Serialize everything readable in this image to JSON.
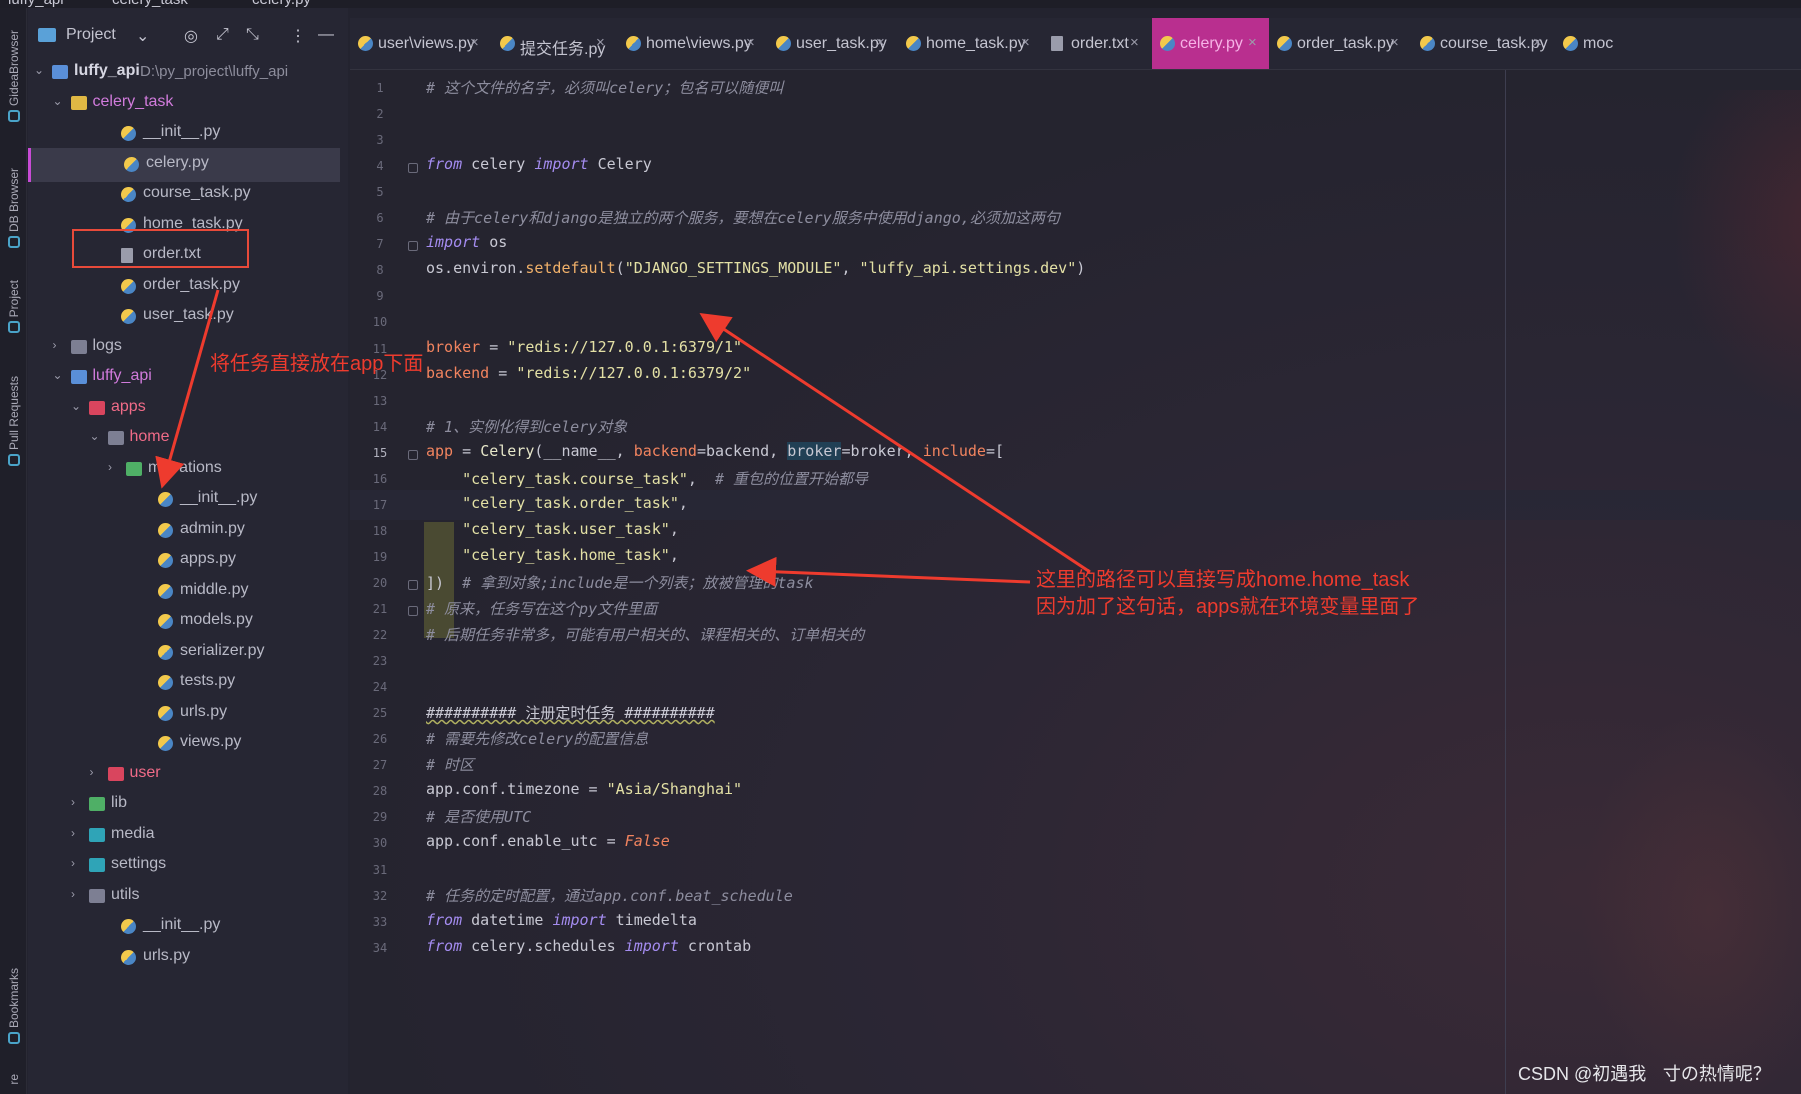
{
  "breadcrumb": {
    "project": "luffy_api",
    "folder": "celery_task",
    "file": "celery.py"
  },
  "left_strip": [
    {
      "label": "GideaBrowser",
      "icon": "gidea-icon"
    },
    {
      "label": "DB Browser",
      "icon": "database-icon"
    },
    {
      "label": "Project",
      "icon": "project-icon"
    },
    {
      "label": "Pull Requests",
      "icon": "github-icon"
    },
    {
      "label": "Bookmarks",
      "icon": "bookmark-icon"
    },
    {
      "label": "re",
      "icon": ""
    }
  ],
  "project_toolbar": {
    "title": "Project"
  },
  "tree": [
    {
      "label": "luffy_api",
      "extra": "D:\\py_project\\luffy_api",
      "type": "folderblue",
      "depth": 0,
      "expanded": true,
      "bold": true
    },
    {
      "label": "celery_task",
      "type": "folder",
      "depth": 1,
      "expanded": true,
      "color": "pink"
    },
    {
      "label": "__init__.py",
      "type": "py",
      "depth": 2
    },
    {
      "label": "celery.py",
      "type": "py",
      "depth": 2,
      "selected": true
    },
    {
      "label": "course_task.py",
      "type": "py",
      "depth": 2
    },
    {
      "label": "home_task.py",
      "type": "py",
      "depth": 2
    },
    {
      "label": "order.txt",
      "type": "txt",
      "depth": 2
    },
    {
      "label": "order_task.py",
      "type": "py",
      "depth": 2
    },
    {
      "label": "user_task.py",
      "type": "py",
      "depth": 2
    },
    {
      "label": "logs",
      "type": "foldergray",
      "depth": 1,
      "collapsed": true
    },
    {
      "label": "luffy_api",
      "type": "folderblue",
      "depth": 1,
      "expanded": true,
      "color": "pink"
    },
    {
      "label": "apps",
      "type": "folderred",
      "depth": 2,
      "expanded": true,
      "color": "red"
    },
    {
      "label": "home",
      "type": "foldergray",
      "depth": 3,
      "expanded": true,
      "color": "red"
    },
    {
      "label": "migrations",
      "type": "foldergreen",
      "depth": 4,
      "collapsed": true
    },
    {
      "label": "__init__.py",
      "type": "py",
      "depth": 4
    },
    {
      "label": "admin.py",
      "type": "py",
      "depth": 4
    },
    {
      "label": "apps.py",
      "type": "py",
      "depth": 4
    },
    {
      "label": "middle.py",
      "type": "py",
      "depth": 4
    },
    {
      "label": "models.py",
      "type": "py",
      "depth": 4
    },
    {
      "label": "serializer.py",
      "type": "py",
      "depth": 4
    },
    {
      "label": "tests.py",
      "type": "py",
      "depth": 4
    },
    {
      "label": "urls.py",
      "type": "py",
      "depth": 4
    },
    {
      "label": "views.py",
      "type": "py",
      "depth": 4
    },
    {
      "label": "user",
      "type": "folderred",
      "depth": 3,
      "collapsed": true,
      "color": "red"
    },
    {
      "label": "lib",
      "type": "foldergreen",
      "depth": 2,
      "collapsed": true
    },
    {
      "label": "media",
      "type": "folderteal",
      "depth": 2,
      "collapsed": true
    },
    {
      "label": "settings",
      "type": "folderteal",
      "depth": 2,
      "collapsed": true
    },
    {
      "label": "utils",
      "type": "foldergray",
      "depth": 2,
      "collapsed": true
    },
    {
      "label": "__init__.py",
      "type": "py",
      "depth": 2
    },
    {
      "label": "urls.py",
      "type": "py",
      "depth": 2
    }
  ],
  "tabs": [
    {
      "label": "user\\views.py",
      "icon": "py"
    },
    {
      "label": "提交任务.py",
      "icon": "py"
    },
    {
      "label": "home\\views.py",
      "icon": "py"
    },
    {
      "label": "user_task.py",
      "icon": "py"
    },
    {
      "label": "home_task.py",
      "icon": "py"
    },
    {
      "label": "order.txt",
      "icon": "txt"
    },
    {
      "label": "celery.py",
      "icon": "py",
      "active": true
    },
    {
      "label": "order_task.py",
      "icon": "py"
    },
    {
      "label": "course_task.py",
      "icon": "py"
    },
    {
      "label": "moc",
      "icon": "py"
    }
  ],
  "code_lines": [
    [
      [
        "cm",
        "# 这个文件的名字，必须叫celery；包名可以随便叫"
      ]
    ],
    [],
    [],
    [
      [
        "kw",
        "from"
      ],
      [
        "id",
        " celery "
      ],
      [
        "kw",
        "import"
      ],
      [
        "id",
        " Celery"
      ]
    ],
    [],
    [
      [
        "cm",
        "# 由于celery和django是独立的两个服务，要想在celery服务中使用django,必须加这两句"
      ]
    ],
    [
      [
        "kw",
        "import"
      ],
      [
        "id",
        " os"
      ]
    ],
    [
      [
        "id",
        "os.environ."
      ],
      [
        "fn",
        "setdefault"
      ],
      [
        "id",
        "("
      ],
      [
        "str",
        "\"DJANGO_SETTINGS_MODULE\""
      ],
      [
        "id",
        ", "
      ],
      [
        "str",
        "\"luffy_api.settings.dev\""
      ],
      [
        "id",
        ")"
      ]
    ],
    [],
    [],
    [
      [
        "pm",
        "broker"
      ],
      [
        "id",
        " = "
      ],
      [
        "str",
        "\"redis://127.0.0.1:6379/1\""
      ]
    ],
    [
      [
        "pm",
        "backend"
      ],
      [
        "id",
        " = "
      ],
      [
        "str",
        "\"redis://127.0.0.1:6379/2\""
      ]
    ],
    [],
    [
      [
        "cm",
        "# 1、实例化得到celery对象"
      ]
    ],
    [
      [
        "pm",
        "app"
      ],
      [
        "id",
        " = "
      ],
      [
        "cls",
        "Celery"
      ],
      [
        "id",
        "(__name__, "
      ],
      [
        "pm",
        "backend"
      ],
      [
        "id",
        "=backend, "
      ],
      [
        "hl",
        "broker"
      ],
      [
        "id",
        "=broker, "
      ],
      [
        "pm",
        "include"
      ],
      [
        "id",
        "=["
      ]
    ],
    [
      [
        "id",
        "    "
      ],
      [
        "str",
        "\"celery_task.course_task\""
      ],
      [
        "id",
        ",  "
      ],
      [
        "cm",
        "# 重包的位置开始都导"
      ]
    ],
    [
      [
        "id",
        "    "
      ],
      [
        "str",
        "\"celery_task.order_task\""
      ],
      [
        "id",
        ","
      ]
    ],
    [
      [
        "id",
        "    "
      ],
      [
        "str",
        "\"celery_task.user_task\""
      ],
      [
        "id",
        ","
      ]
    ],
    [
      [
        "id",
        "    "
      ],
      [
        "str",
        "\"celery_task.home_task\""
      ],
      [
        "id",
        ","
      ]
    ],
    [
      [
        "id",
        "])  "
      ],
      [
        "cm",
        "# 拿到对象;include是一个列表；放被管理的task"
      ]
    ],
    [
      [
        "cm",
        "# 原来，任务写在这个py文件里面"
      ]
    ],
    [
      [
        "cm",
        "# 后期任务非常多，可能有用户相关的、课程相关的、订单相关的"
      ]
    ],
    [],
    [],
    [
      [
        "ul",
        "########## 注册定时任务 ##########"
      ]
    ],
    [
      [
        "cm",
        "# 需要先修改celery的配置信息"
      ]
    ],
    [
      [
        "cm",
        "# 时区"
      ]
    ],
    [
      [
        "id",
        "app.conf.timezone = "
      ],
      [
        "str",
        "\"Asia/Shanghai\""
      ]
    ],
    [
      [
        "cm",
        "# 是否使用UTC"
      ]
    ],
    [
      [
        "id",
        "app.conf.enable_utc = "
      ],
      [
        "f",
        "False"
      ]
    ],
    [],
    [
      [
        "cm",
        "# 任务的定时配置，通过app.conf.beat_schedule"
      ]
    ],
    [
      [
        "kw",
        "from"
      ],
      [
        "id",
        " datetime "
      ],
      [
        "kw",
        "import"
      ],
      [
        "id",
        " timedelta"
      ]
    ],
    [
      [
        "kw",
        "from"
      ],
      [
        "id",
        " celery.schedules "
      ],
      [
        "kw",
        "import"
      ],
      [
        "id",
        " crontab"
      ]
    ]
  ],
  "annotations": {
    "left_note": "将任务直接放在app下面",
    "right_note_line1": "这里的路径可以直接写成home.home_task",
    "right_note_line2": "因为加了这句话，apps就在环境变量里面了"
  },
  "colors": {
    "active_tab": "#b92f8f",
    "annotation": "#ee3b2e",
    "selected_marker": "#c84bd6"
  },
  "watermark": "CSDN @初遇我ㅤ寸の热情呢？"
}
